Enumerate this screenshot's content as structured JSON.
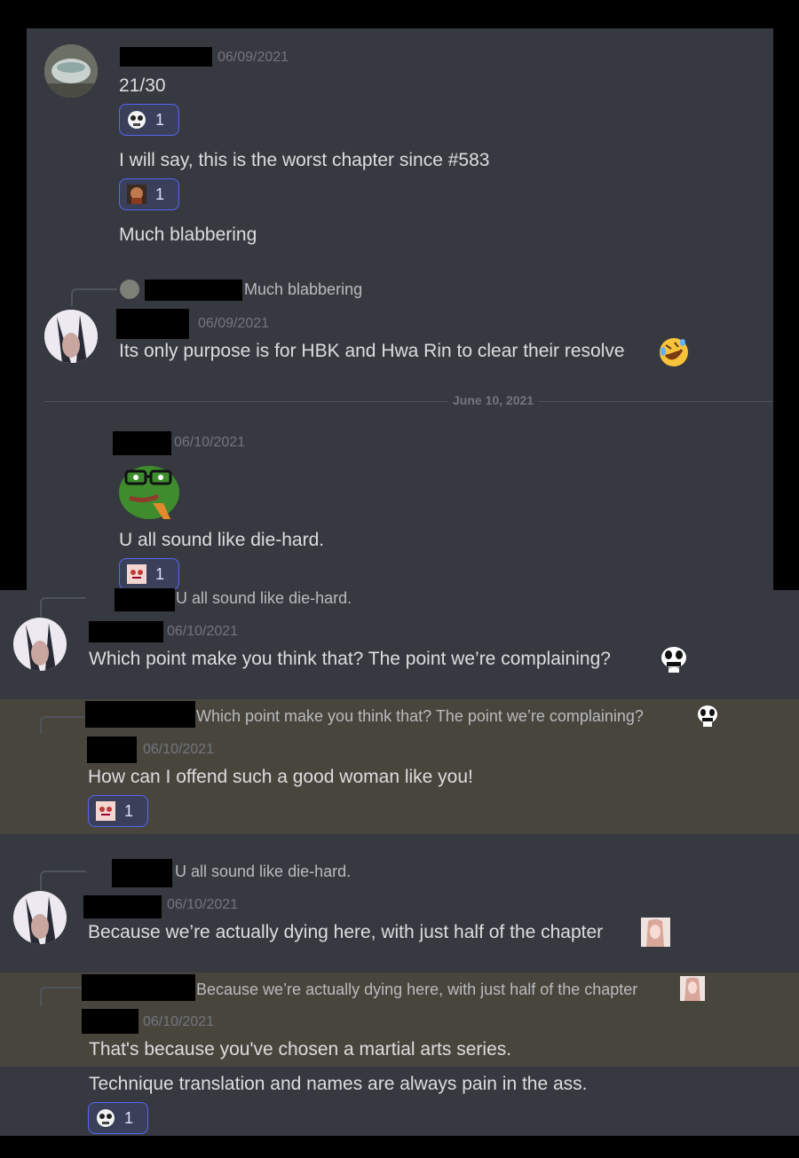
{
  "thread": {
    "msg1": {
      "timestamp": "06/09/2021",
      "lines": [
        "21/30",
        "I will say, this is the worst chapter since #583",
        "Much blabbering"
      ],
      "reactions": [
        {
          "emoji": "pepe-skull-emoji",
          "count": "1"
        },
        {
          "emoji": "man-face-emoji",
          "count": "1"
        }
      ]
    },
    "msg2": {
      "reply_preview": "Much blabbering",
      "timestamp": "06/09/2021",
      "text": "Its only purpose is for HBK and Hwa Rin to clear their resolve",
      "emoji": "rofl-emoji"
    },
    "date_divider": "June 10, 2021",
    "msg3": {
      "timestamp": "06/10/2021",
      "sticker": "pepe-glasses-sticker",
      "text": "U all sound like die-hard.",
      "reaction": {
        "emoji": "anime-face-emoji",
        "count": "1"
      }
    },
    "msg4": {
      "reply_preview": "U all sound like die-hard.",
      "timestamp": "06/10/2021",
      "text": "Which point make you think that? The point we’re complaining?",
      "emoji": "grin-face-emoji"
    },
    "msg5": {
      "reply_preview": "Which point make you think that? The point we’re complaining?",
      "timestamp": "06/10/2021",
      "text": "How can I offend such a good woman like you!",
      "reaction": {
        "emoji": "anime-face-emoji",
        "count": "1"
      }
    },
    "msg6": {
      "reply_preview": "U all sound like die-hard.",
      "timestamp": "06/10/2021",
      "text": "Because we’re actually dying here, with just half of the chapter",
      "emoji": "anime-girl-emoji"
    },
    "msg7": {
      "reply_preview": "Because we’re actually dying here, with just half of the chapter",
      "timestamp": "06/10/2021",
      "lines": [
        "That's because you've chosen a martial arts series.",
        "Technique translation and names are always pain in the ass."
      ],
      "reaction": {
        "emoji": "pepe-skull-emoji",
        "count": "1"
      }
    }
  },
  "colors": {
    "background": "#36393f",
    "highlight": "#48453d",
    "text": "#dcddde",
    "muted": "#72767d",
    "reaction_border": "#5865f2"
  }
}
